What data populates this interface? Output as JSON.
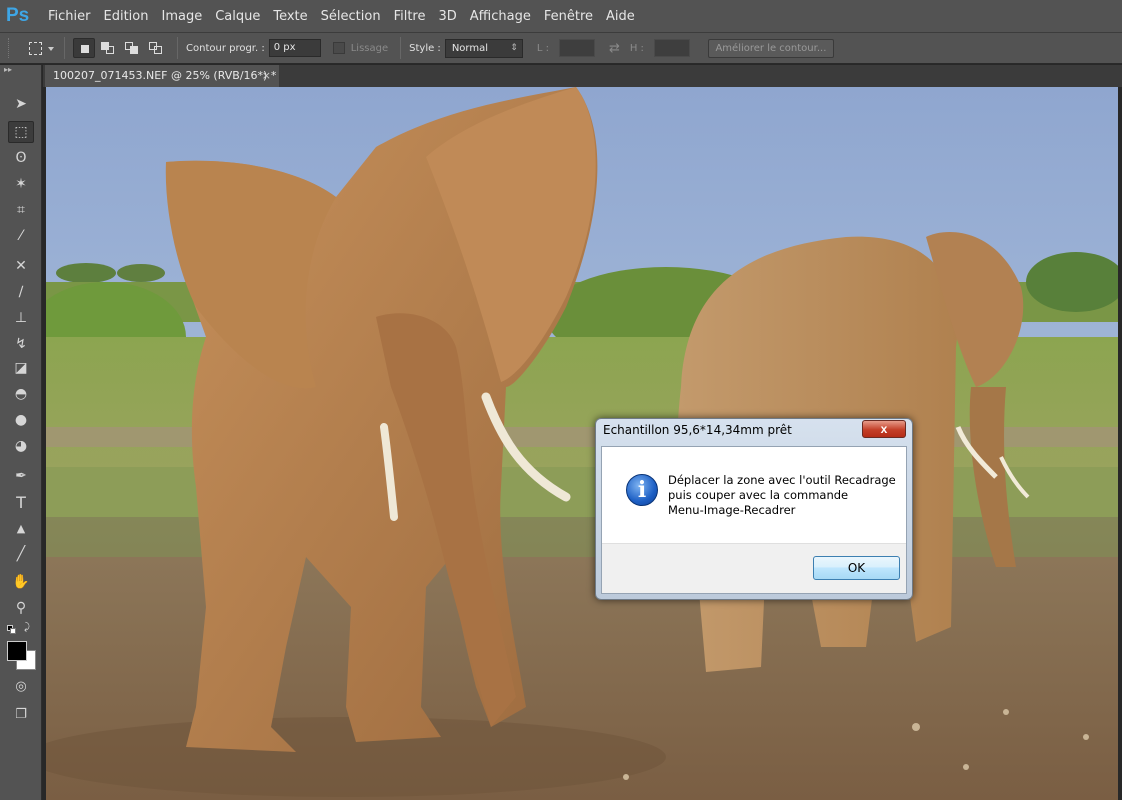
{
  "app": {
    "logo": "Ps"
  },
  "menu": [
    "Fichier",
    "Edition",
    "Image",
    "Calque",
    "Texte",
    "Sélection",
    "Filtre",
    "3D",
    "Affichage",
    "Fenêtre",
    "Aide"
  ],
  "options": {
    "contour_label": "Contour progr. :",
    "contour_value": "0 px",
    "lissage_label": "Lissage",
    "style_label": "Style :",
    "style_value": "Normal",
    "width_label": "L :",
    "height_label": "H :",
    "refine_label": "Améliorer le contour..."
  },
  "document": {
    "tab_title": "100207_071453.NEF @ 25% (RVB/16*) *",
    "close_symbol": "×"
  },
  "tools": [
    {
      "name": "move-tool",
      "glyph": "➤"
    },
    {
      "name": "marquee-tool",
      "glyph": "⬚"
    },
    {
      "name": "lasso-tool",
      "glyph": "ʘ"
    },
    {
      "name": "magic-wand-tool",
      "glyph": "✶"
    },
    {
      "name": "crop-tool",
      "glyph": "⌗"
    },
    {
      "name": "eyedropper-tool",
      "glyph": "⁄"
    },
    {
      "name": "healing-tool",
      "glyph": "✕"
    },
    {
      "name": "brush-tool",
      "glyph": "∕"
    },
    {
      "name": "stamp-tool",
      "glyph": "⊥"
    },
    {
      "name": "history-brush-tool",
      "glyph": "↯"
    },
    {
      "name": "eraser-tool",
      "glyph": "◪"
    },
    {
      "name": "bucket-tool",
      "glyph": "◓"
    },
    {
      "name": "blur-tool",
      "glyph": "●"
    },
    {
      "name": "dodge-tool",
      "glyph": "◕"
    },
    {
      "name": "pen-tool",
      "glyph": "✒"
    },
    {
      "name": "type-tool",
      "glyph": "T"
    },
    {
      "name": "path-selection-tool",
      "glyph": "▲"
    },
    {
      "name": "line-tool",
      "glyph": "╱"
    },
    {
      "name": "hand-tool",
      "glyph": "✋"
    },
    {
      "name": "zoom-tool",
      "glyph": "⚲"
    }
  ],
  "dialog": {
    "title": "Echantillon 95,6*14,34mm prêt",
    "close_label": "x",
    "info_glyph": "i",
    "lines": [
      "Déplacer la zone avec l'outil Recadrage",
      "puis couper avec la commande",
      "Menu-Image-Recadrer"
    ],
    "ok_label": "OK"
  },
  "colors": {
    "foreground": "#000000",
    "background": "#ffffff",
    "ps_accent": "#3ea6e6"
  }
}
